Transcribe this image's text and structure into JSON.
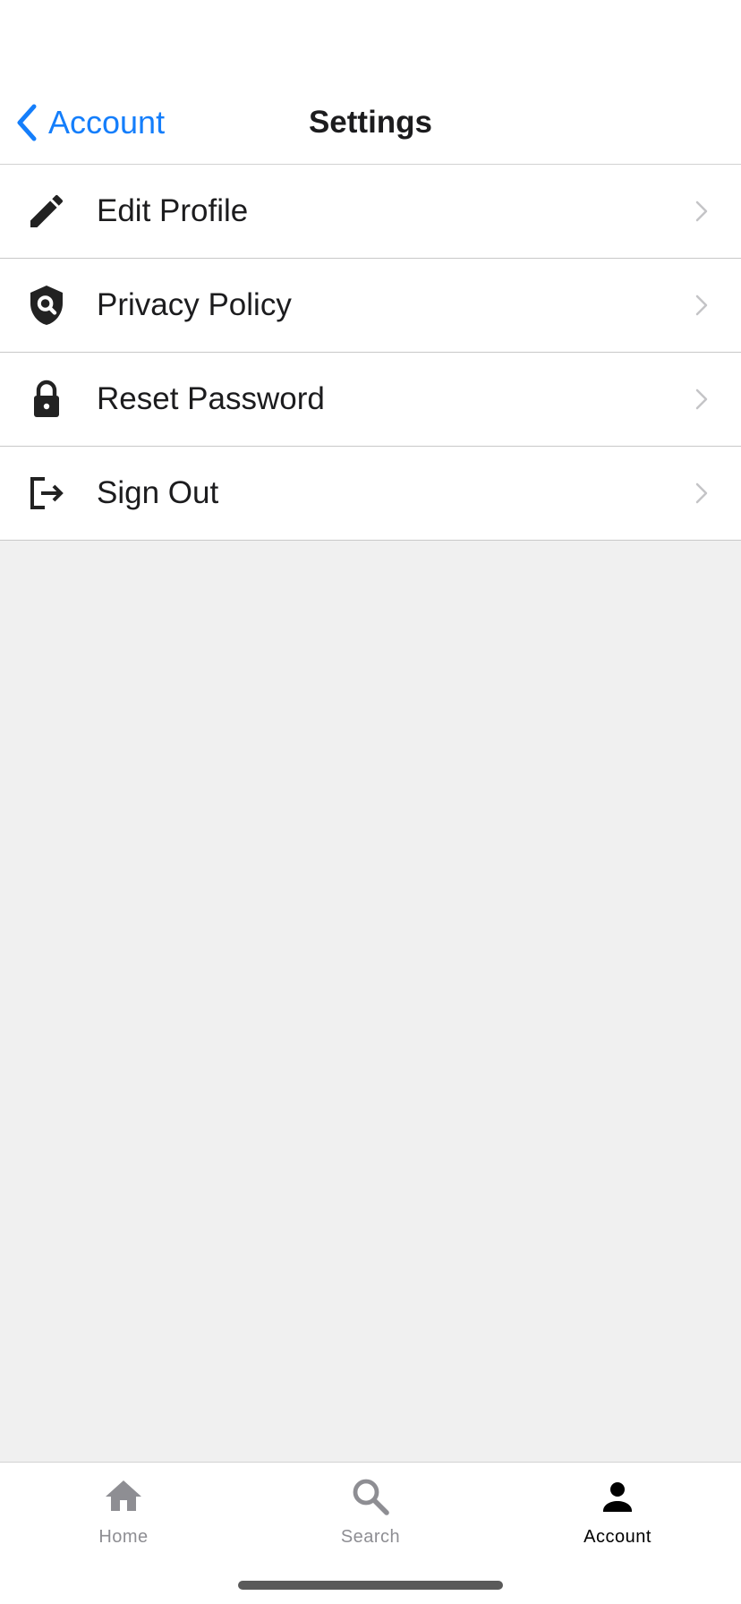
{
  "nav": {
    "back_label": "Account",
    "title": "Settings"
  },
  "menu": {
    "items": [
      {
        "label": "Edit Profile",
        "icon": "pencil-icon"
      },
      {
        "label": "Privacy Policy",
        "icon": "shield-search-icon"
      },
      {
        "label": "Reset Password",
        "icon": "lock-icon"
      },
      {
        "label": "Sign Out",
        "icon": "sign-out-icon"
      }
    ]
  },
  "tabs": {
    "items": [
      {
        "label": "Home",
        "icon": "home-icon",
        "active": false
      },
      {
        "label": "Search",
        "icon": "search-icon",
        "active": false
      },
      {
        "label": "Account",
        "icon": "person-icon",
        "active": true
      }
    ]
  },
  "colors": {
    "accent": "#147efb",
    "text": "#1c1c1e",
    "background": "#f0f0f0",
    "inactive_tab": "#8e8e93"
  }
}
